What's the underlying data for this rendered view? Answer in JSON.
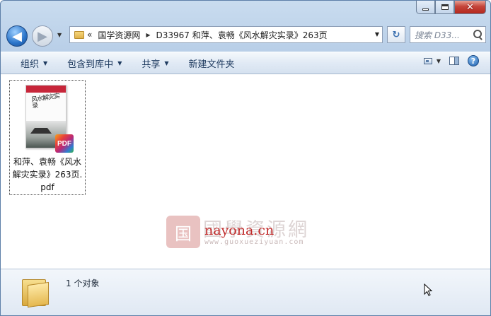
{
  "window": {
    "caption": {
      "minimize": "",
      "maximize": "",
      "close": "✕"
    }
  },
  "nav": {
    "back_glyph": "◀",
    "forward_glyph": "▶",
    "dropdown_glyph": "▼",
    "breadcrumb": {
      "overflow": "«",
      "items": [
        "国学资源网",
        "D33967 和萍、袁畅《风水解灾实录》263页"
      ],
      "separator": "▶"
    },
    "refresh_glyph": "↻",
    "search_placeholder": "搜索 D33..."
  },
  "toolbar": {
    "items": [
      {
        "label": "组织",
        "has_menu": true
      },
      {
        "label": "包含到库中",
        "has_menu": true
      },
      {
        "label": "共享",
        "has_menu": true
      },
      {
        "label": "新建文件夹",
        "has_menu": false
      }
    ],
    "help_glyph": "?"
  },
  "content": {
    "files": [
      {
        "name": "和萍、袁畅《风水解灾实录》263页.pdf",
        "type_badge": "PDF",
        "cover_text": "风水解灾实录"
      }
    ],
    "watermark": {
      "seal": "国",
      "cn_text": "國學資源網",
      "domain": "nayona.cn",
      "url": "www.guoxueziyuan.com"
    }
  },
  "status": {
    "count_text": "1 个对象"
  }
}
